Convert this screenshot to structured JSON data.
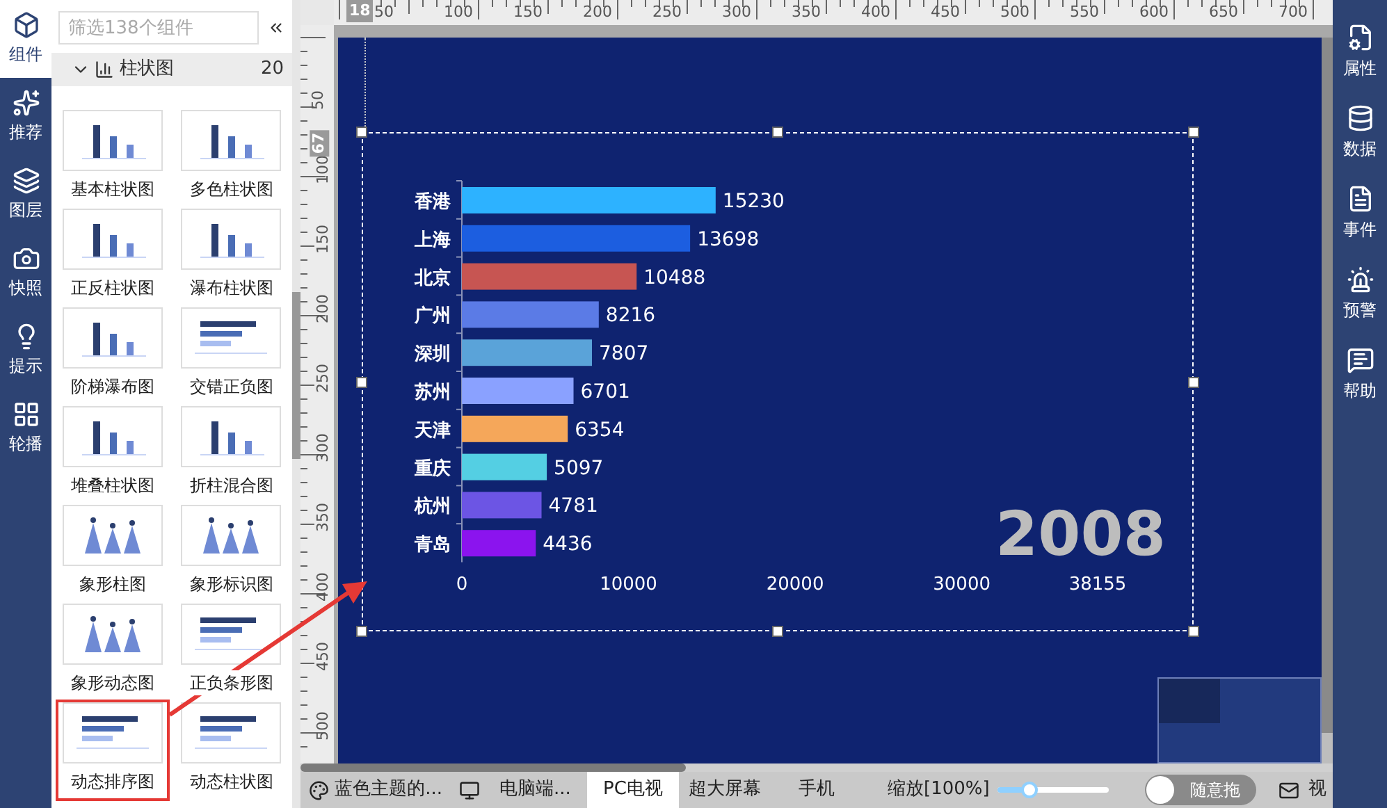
{
  "left_rail": {
    "items": [
      {
        "label": "组件",
        "selected": true
      },
      {
        "label": "推荐",
        "selected": false
      },
      {
        "label": "图层",
        "selected": false
      },
      {
        "label": "快照",
        "selected": false
      },
      {
        "label": "提示",
        "selected": false
      },
      {
        "label": "轮播",
        "selected": false
      }
    ]
  },
  "component_panel": {
    "search": {
      "placeholder": "筛选138个组件"
    },
    "category": {
      "label": "柱状图",
      "count": "20",
      "expanded": true
    },
    "items": [
      {
        "label": "基本柱状图",
        "selected": false
      },
      {
        "label": "多色柱状图",
        "selected": false
      },
      {
        "label": "正反柱状图",
        "selected": false
      },
      {
        "label": "瀑布柱状图",
        "selected": false
      },
      {
        "label": "阶梯瀑布图",
        "selected": false
      },
      {
        "label": "交错正负图",
        "selected": false
      },
      {
        "label": "堆叠柱状图",
        "selected": false
      },
      {
        "label": "折柱混合图",
        "selected": false
      },
      {
        "label": "象形柱图",
        "selected": false
      },
      {
        "label": "象形标识图",
        "selected": false
      },
      {
        "label": "象形动态图",
        "selected": false
      },
      {
        "label": "正负条形图",
        "selected": false
      },
      {
        "label": "动态排序图",
        "selected": true
      },
      {
        "label": "动态柱状图",
        "selected": false
      }
    ]
  },
  "rulers": {
    "top_marker": "18",
    "top_labels": [
      "50",
      "100",
      "150",
      "200",
      "250",
      "300",
      "350",
      "400",
      "450",
      "500",
      "550",
      "600",
      "650",
      "700"
    ],
    "left_marker": "67",
    "left_labels": [
      "50",
      "100",
      "150",
      "200",
      "250",
      "300",
      "350",
      "400",
      "450",
      "500"
    ]
  },
  "canvas": {
    "chart": {
      "chart_data": {
        "type": "bar",
        "orientation": "horizontal",
        "categories": [
          "香港",
          "上海",
          "北京",
          "广州",
          "深圳",
          "苏州",
          "天津",
          "重庆",
          "杭州",
          "青岛"
        ],
        "series": [
          {
            "name": "2008",
            "values": [
              15230,
              13698,
              10488,
              8216,
              7807,
              6701,
              6354,
              5097,
              4781,
              4436
            ],
            "colors": [
              "#2db2ff",
              "#1c5ee0",
              "#c75552",
              "#5b7be6",
              "#5aa3d9",
              "#8aa1ff",
              "#f5a75a",
              "#54cfe3",
              "#6c55e4",
              "#8b14ee"
            ]
          }
        ],
        "xlim": [
          0,
          38155
        ],
        "xticks": [
          0,
          10000,
          20000,
          30000,
          38155
        ],
        "data_labels": true
      }
    }
  },
  "bottom_bar": {
    "tabs": [
      {
        "label": "蓝色主题的...",
        "selected": false,
        "kind": "theme"
      },
      {
        "label": "电脑端...",
        "selected": false,
        "kind": "device"
      },
      {
        "label": "PC电视",
        "selected": true,
        "kind": "plain"
      },
      {
        "label": "超大屏幕",
        "selected": false,
        "kind": "plain"
      },
      {
        "label": "手机",
        "selected": false,
        "kind": "plain"
      }
    ],
    "zoom": {
      "label": "缩放[100%]",
      "level": 0.28
    },
    "drag_toggle": {
      "label": "随意拖",
      "on": false
    },
    "view": {
      "label": "视"
    }
  },
  "right_rail": {
    "items": [
      {
        "label": "属性"
      },
      {
        "label": "数据"
      },
      {
        "label": "事件"
      },
      {
        "label": "预警"
      },
      {
        "label": "帮助"
      }
    ]
  }
}
